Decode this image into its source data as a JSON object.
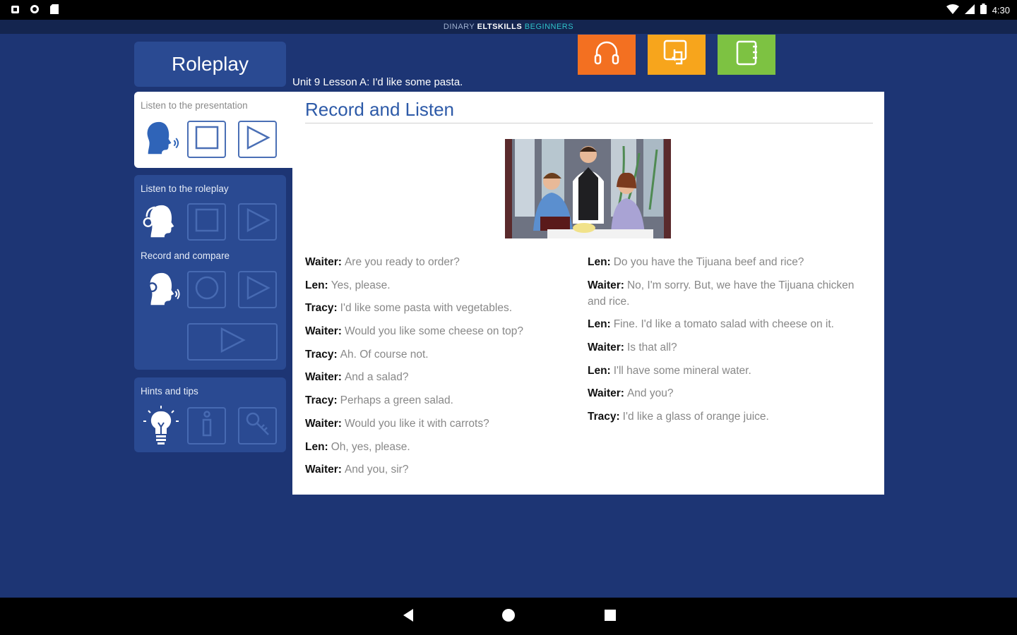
{
  "status": {
    "time": "4:30"
  },
  "brand": {
    "part1": "DINARY ",
    "part2": "ELTSKILLS ",
    "part3": "BEGINNERS"
  },
  "header": {
    "tab_label": "Roleplay",
    "lesson": "Unit 9 Lesson A: I'd like some pasta."
  },
  "top_buttons": [
    {
      "name": "headphones",
      "color": "#f37021"
    },
    {
      "name": "touch",
      "color": "#f7a51c"
    },
    {
      "name": "notebook",
      "color": "#7dc242"
    }
  ],
  "sidebar": {
    "presentation_label": "Listen to the presentation",
    "roleplay_label": "Listen to the roleplay",
    "record_label": "Record and compare",
    "hints_label": "Hints and tips"
  },
  "content": {
    "title": "Record and Listen",
    "left_lines": [
      {
        "speaker": "Waiter:",
        "text": "Are you ready to order?"
      },
      {
        "speaker": "Len:",
        "text": "Yes, please."
      },
      {
        "speaker": "Tracy:",
        "text": "I'd like some pasta with vegetables."
      },
      {
        "speaker": "Waiter:",
        "text": "Would you like some cheese on top?"
      },
      {
        "speaker": "Tracy:",
        "text": "Ah. Of course not."
      },
      {
        "speaker": "Waiter:",
        "text": "And a salad?"
      },
      {
        "speaker": "Tracy:",
        "text": "Perhaps a green salad."
      },
      {
        "speaker": "Waiter:",
        "text": "Would you like it with carrots?"
      },
      {
        "speaker": "Len:",
        "text": "Oh, yes, please."
      },
      {
        "speaker": "Waiter:",
        "text": "And you, sir?"
      }
    ],
    "right_lines": [
      {
        "speaker": "Len:",
        "text": "Do you have the Tijuana beef and rice?"
      },
      {
        "speaker": "Waiter:",
        "text": "No, I'm sorry. But, we have the Tijuana chicken and rice."
      },
      {
        "speaker": "Len:",
        "text": "Fine. I'd like a tomato salad with cheese on it."
      },
      {
        "speaker": "Waiter:",
        "text": "Is that all?"
      },
      {
        "speaker": "Len:",
        "text": "I'll have some mineral water."
      },
      {
        "speaker": "Waiter:",
        "text": "And you?"
      },
      {
        "speaker": "Tracy:",
        "text": "I'd like a glass of orange juice."
      }
    ]
  },
  "colors": {
    "background": "#1d3574",
    "card": "#2a4a92",
    "accent": "#2d5aa8"
  }
}
